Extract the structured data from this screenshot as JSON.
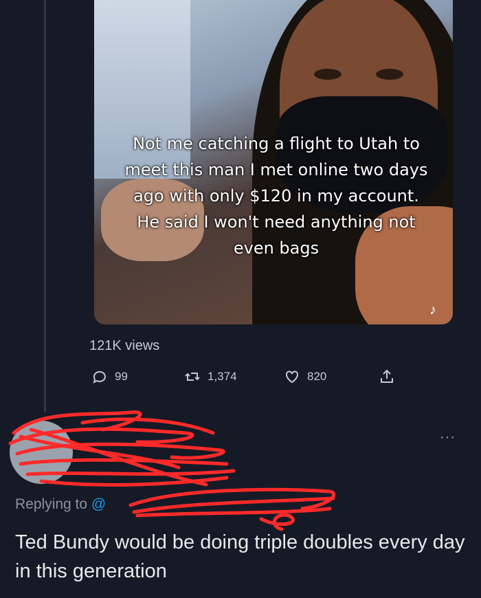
{
  "media": {
    "caption": "Not me catching a flight to Utah to meet this man I met online two days ago with only $120 in my account. He said I won't need anything not even bags"
  },
  "stats": {
    "views": "121K views",
    "replies": "99",
    "retweets": "1,374",
    "likes": "820"
  },
  "icons": {
    "reply": "reply-icon",
    "retweet": "retweet-icon",
    "like": "heart-icon",
    "share": "share-icon",
    "more": "more-icon"
  },
  "reply": {
    "replying_label": "Replying to",
    "handle": "@",
    "text": "Ted Bundy would be doing triple doubles every day in this generation",
    "more": "···"
  },
  "colors": {
    "background": "#151a26",
    "link": "#1d9bf0",
    "redaction": "#ff2a2a"
  }
}
